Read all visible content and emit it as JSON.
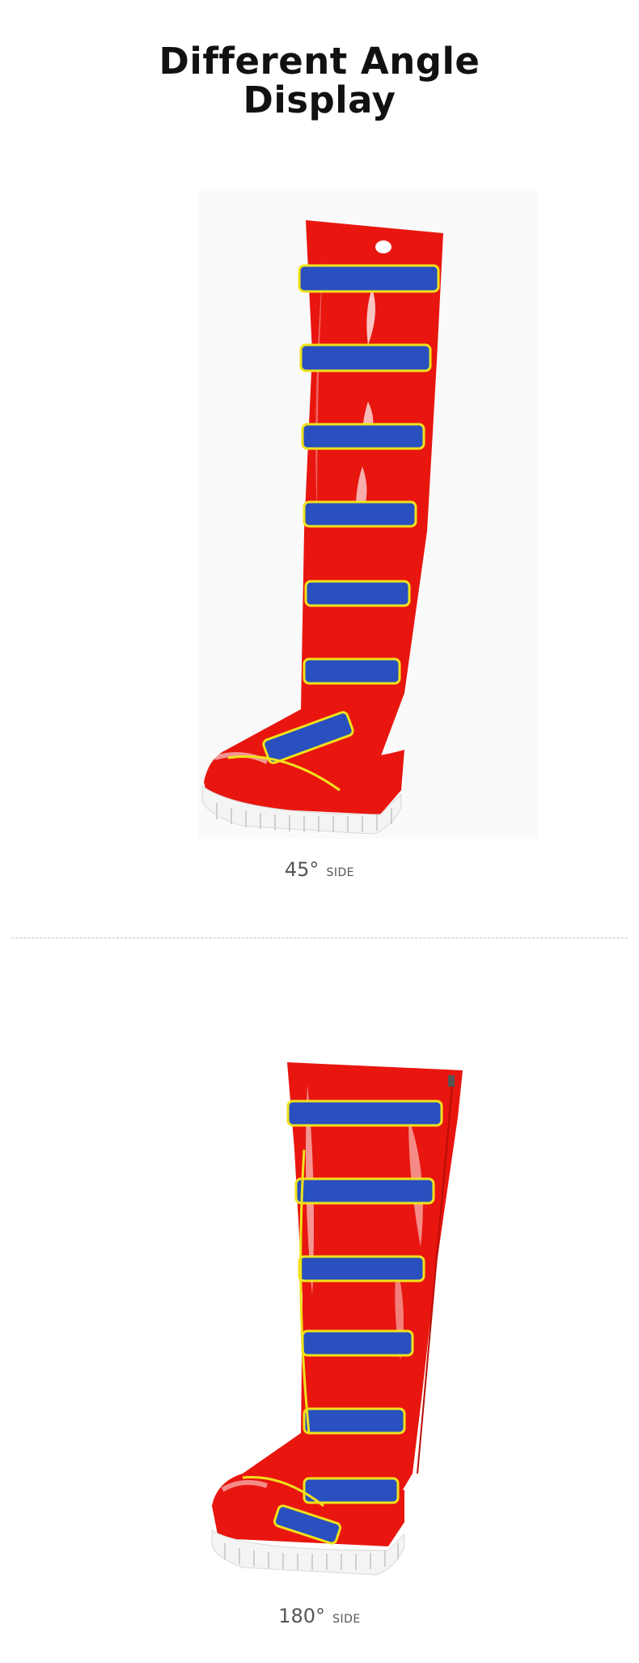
{
  "heading": {
    "line1": "Different Angle",
    "line2": "Display"
  },
  "views": [
    {
      "angle": "45°",
      "label": "SIDE"
    },
    {
      "angle": "180°",
      "label": "SIDE"
    }
  ],
  "colors": {
    "boot_red": "#e8160f",
    "strap_blue": "#2a4fbf",
    "piping_yellow": "#f0e21b",
    "sole_white": "#f4f4f4"
  }
}
